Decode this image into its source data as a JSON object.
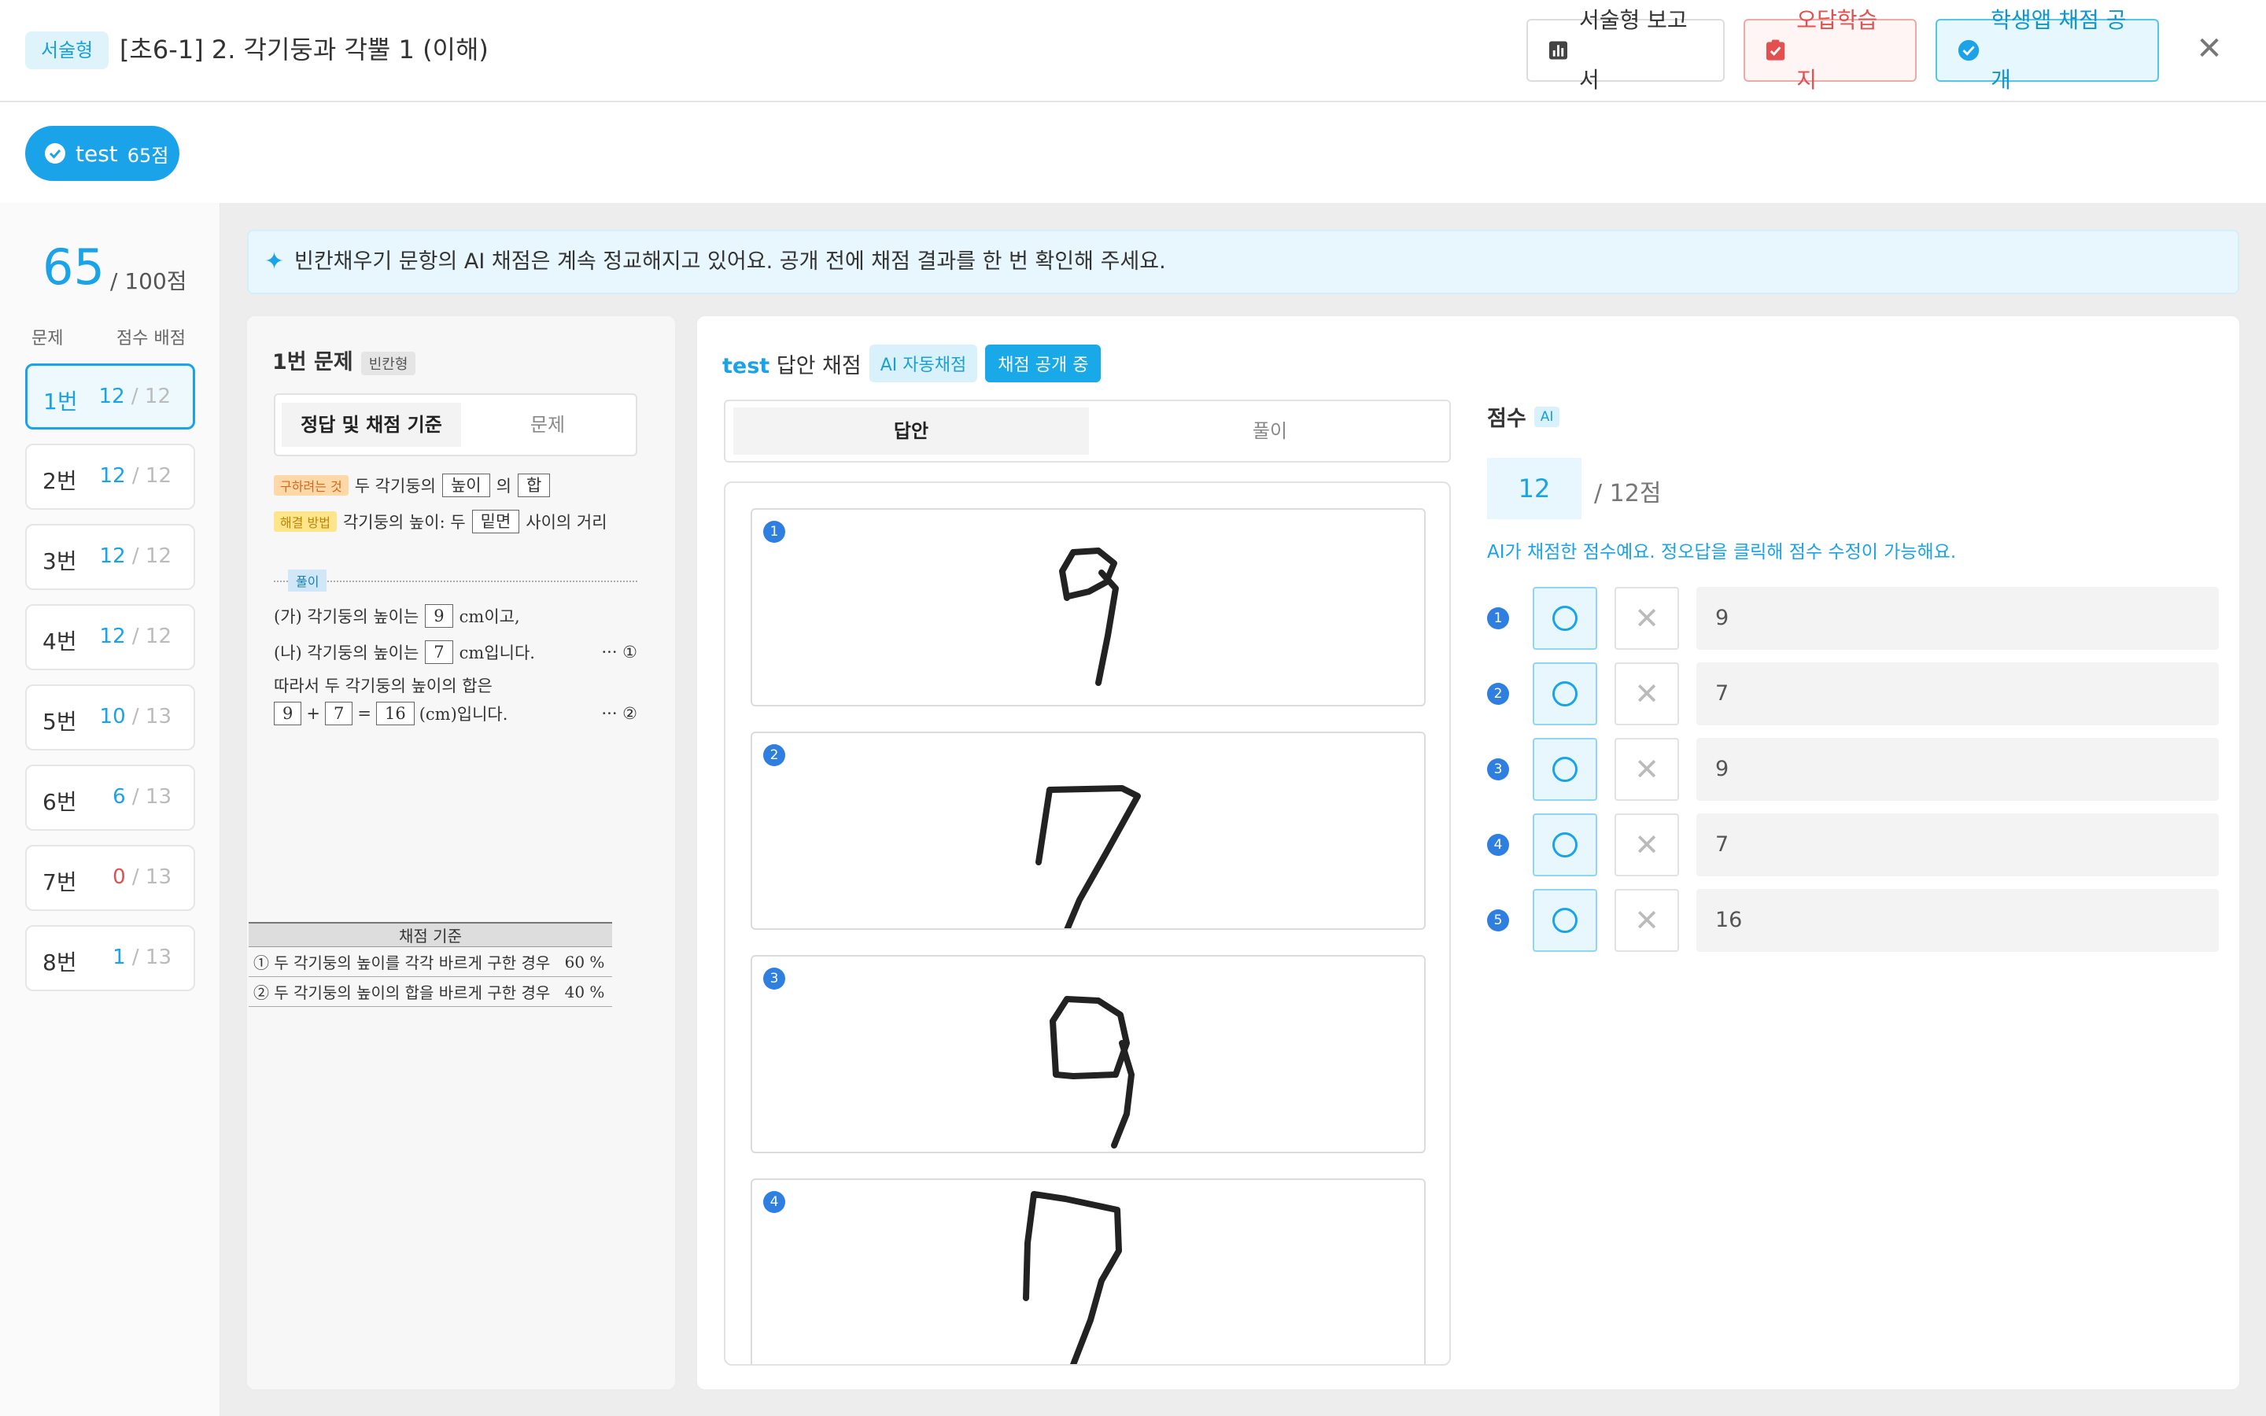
{
  "header": {
    "type_badge": "서술형",
    "title": "[초6-1] 2. 각기둥과 각뿔 1 (이해)",
    "report_btn": "서술형 보고서",
    "wrong_btn": "오답학습지",
    "open_btn": "학생앱 채점 공개",
    "close": "✕"
  },
  "student": {
    "name": "test",
    "score": "65점"
  },
  "sidebar": {
    "total": "65",
    "total_sub": "/ 100점",
    "col1": "문제",
    "col2": "점수 배점",
    "items": [
      {
        "label": "1번",
        "got": "12",
        "max": "/ 12"
      },
      {
        "label": "2번",
        "got": "12",
        "max": "/ 12"
      },
      {
        "label": "3번",
        "got": "12",
        "max": "/ 12"
      },
      {
        "label": "4번",
        "got": "12",
        "max": "/ 12"
      },
      {
        "label": "5번",
        "got": "10",
        "max": "/ 13"
      },
      {
        "label": "6번",
        "got": "6",
        "max": "/ 13"
      },
      {
        "label": "7번",
        "got": "0",
        "max": "/ 13"
      },
      {
        "label": "8번",
        "got": "1",
        "max": "/ 13"
      }
    ]
  },
  "notice": "빈칸채우기 문항의 AI 채점은 계속 정교해지고 있어요. 공개 전에 채점 결과를 한 번 확인해 주세요.",
  "problem": {
    "title": "1번 문제",
    "tag": "빈칸형",
    "tab_answer": "정답 및 채점 기준",
    "tab_problem": "문제",
    "goal_label": "구하려는 것",
    "goal_text1": "두 각기둥의",
    "goal_box1": "높이",
    "goal_text2": "의",
    "goal_box2": "합",
    "method_label": "해결 방법",
    "method_text1": "각기둥의 높이: 두",
    "method_box": "밑면",
    "method_text2": "사이의 거리",
    "sol_label": "풀이",
    "l1a": "(가) 각기둥의 높이는",
    "l1b": "9",
    "l1c": "cm이고,",
    "l2a": "(나) 각기둥의 높이는",
    "l2b": "7",
    "l2c": "cm입니다.",
    "l2m": "··· ①",
    "l3": "따라서 두 각기둥의 높이의 합은",
    "l4a": "9",
    "l4op": "+",
    "l4b": "7",
    "l4eq": "=",
    "l4c": "16",
    "l4d": "(cm)입니다.",
    "l4m": "··· ②",
    "crit_title": "채점 기준",
    "crit1": "① 두 각기둥의 높이를 각각 바르게 구한 경우",
    "crit1_pct": "60 %",
    "crit2": "② 두 각기둥의 높이의 합을 바르게 구한 경우",
    "crit2_pct": "40 %"
  },
  "grading": {
    "student": "test",
    "title": "답안 채점",
    "ai_badge": "AI 자동채점",
    "open_badge": "채점 공개 중",
    "tab_answer": "답안",
    "tab_solution": "풀이",
    "answers": [
      "1",
      "2",
      "3",
      "4"
    ],
    "score_label": "점수",
    "ai_mini": "AI",
    "score": "12",
    "score_max": "/ 12점",
    "note": "AI가 채점한 점수예요. 정오답을 클릭해 점수 수정이 가능해요.",
    "rows": [
      {
        "n": "1",
        "value": "9"
      },
      {
        "n": "2",
        "value": "7"
      },
      {
        "n": "3",
        "value": "9"
      },
      {
        "n": "4",
        "value": "7"
      },
      {
        "n": "5",
        "value": "16"
      }
    ]
  }
}
